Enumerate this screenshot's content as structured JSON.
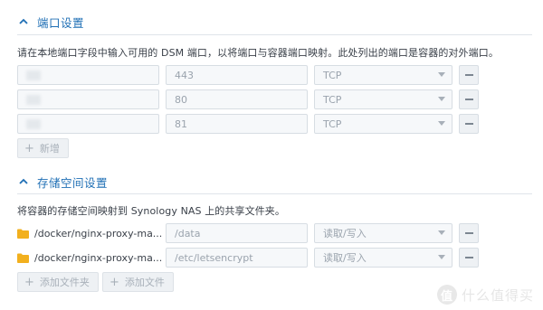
{
  "ports_section": {
    "title": "端口设置",
    "description": "请在本地端口字段中输入可用的 DSM 端口，以将端口与容器端口映射。此处列出的端口是容器的对外端口。",
    "rows": [
      {
        "local_port": "",
        "container_port": "443",
        "protocol": "TCP"
      },
      {
        "local_port": "",
        "container_port": "80",
        "protocol": "TCP"
      },
      {
        "local_port": "",
        "container_port": "81",
        "protocol": "TCP"
      }
    ],
    "add_label": "新增"
  },
  "storage_section": {
    "title": "存储空间设置",
    "description": "将容器的存储空间映射到 Synology NAS 上的共享文件夹。",
    "rows": [
      {
        "path": "/docker/nginx-proxy-ma...",
        "mount": "/data",
        "mode": "读取/写入"
      },
      {
        "path": "/docker/nginx-proxy-ma...",
        "mount": "/etc/letsencrypt",
        "mode": "读取/写入"
      }
    ],
    "add_folder_label": "添加文件夹",
    "add_file_label": "添加文件"
  },
  "watermark": {
    "logo_text": "值",
    "text": "什么值得买"
  },
  "colors": {
    "accent": "#1f6fb5",
    "folder": "#f2b01e"
  },
  "icons": {
    "collapse": "chevron-up-icon",
    "remove": "minus-icon",
    "add": "plus-icon",
    "folder": "folder-icon",
    "dropdown": "caret-down-icon"
  }
}
